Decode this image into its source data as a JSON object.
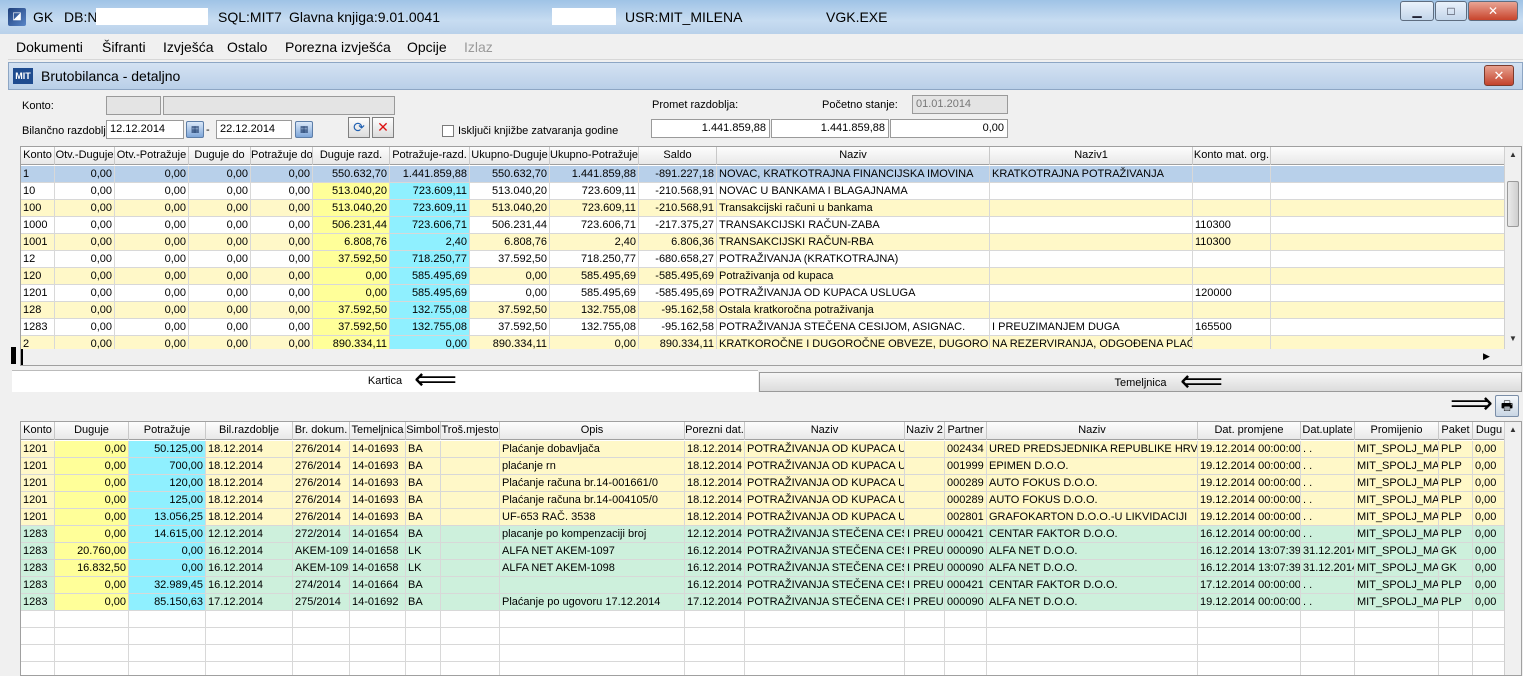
{
  "titlebar": {
    "app": "GK",
    "db": "DB:N",
    "sql": "SQL:MIT7",
    "ledger": "Glavna knjiga:9.01.0041",
    "user": "USR:MIT_MILENA",
    "exe": "VGK.EXE",
    "min": "▁",
    "max": "□",
    "close": "✕"
  },
  "menu": [
    "Dokumenti",
    "Šifranti",
    "Izvješća",
    "Ostalo",
    "Porezna izvješća",
    "Opcije",
    "Izlaz"
  ],
  "window": {
    "logo": "MIT",
    "title": "Brutobilanca - detaljno",
    "close": "✕"
  },
  "form": {
    "konto_label": "Konto:",
    "konto_value": "",
    "konto_name": "",
    "period_label": "Bilančno razdoblje:",
    "date_from": "12.12.2014",
    "date_sep": "-",
    "date_to": "22.12.2014",
    "checkbox_label": "Isključi knjižbe zatvaranja godine",
    "promet_label": "Promet razdoblja:",
    "pocetno_label": "Početno stanje:",
    "pocetno_value": "01.01.2014",
    "total_duguje": "1.441.859,88",
    "total_potrazuje": "1.441.859,88",
    "total_saldo": "0,00",
    "refresh_icon": "⟳",
    "clear_icon": "✕"
  },
  "top_grid": {
    "headers": [
      "Konto",
      "Otv.-Duguje",
      "Otv.-Potražuje",
      "Duguje do",
      "Potražuje do",
      "Duguje razd.",
      "Potražuje-razd.",
      "Ukupno-Duguje",
      "Ukupno-Potražuje",
      "Saldo",
      "Naziv",
      "Naziv1",
      "Konto mat. org."
    ],
    "rows": [
      [
        "1",
        "0,00",
        "0,00",
        "0,00",
        "0,00",
        "550.632,70",
        "1.441.859,88",
        "550.632,70",
        "1.441.859,88",
        "-891.227,18",
        "NOVAC, KRATKOTRAJNA FINANCIJSKA IMOVINA",
        "KRATKOTRAJNA POTRAŽIVANJA",
        ""
      ],
      [
        "10",
        "0,00",
        "0,00",
        "0,00",
        "0,00",
        "513.040,20",
        "723.609,11",
        "513.040,20",
        "723.609,11",
        "-210.568,91",
        "NOVAC U BANKAMA I BLAGAJNAMA",
        "",
        ""
      ],
      [
        "100",
        "0,00",
        "0,00",
        "0,00",
        "0,00",
        "513.040,20",
        "723.609,11",
        "513.040,20",
        "723.609,11",
        "-210.568,91",
        "Transakcijski računi u bankama",
        "",
        ""
      ],
      [
        "1000",
        "0,00",
        "0,00",
        "0,00",
        "0,00",
        "506.231,44",
        "723.606,71",
        "506.231,44",
        "723.606,71",
        "-217.375,27",
        "TRANSAKCIJSKI RAČUN-ZABA",
        "",
        "110300"
      ],
      [
        "1001",
        "0,00",
        "0,00",
        "0,00",
        "0,00",
        "6.808,76",
        "2,40",
        "6.808,76",
        "2,40",
        "6.806,36",
        "TRANSAKCIJSKI RAČUN-RBA",
        "",
        "110300"
      ],
      [
        "12",
        "0,00",
        "0,00",
        "0,00",
        "0,00",
        "37.592,50",
        "718.250,77",
        "37.592,50",
        "718.250,77",
        "-680.658,27",
        "POTRAŽIVANJA (KRATKOTRAJNA)",
        "",
        ""
      ],
      [
        "120",
        "0,00",
        "0,00",
        "0,00",
        "0,00",
        "0,00",
        "585.495,69",
        "0,00",
        "585.495,69",
        "-585.495,69",
        "Potraživanja od kupaca",
        "",
        ""
      ],
      [
        "1201",
        "0,00",
        "0,00",
        "0,00",
        "0,00",
        "0,00",
        "585.495,69",
        "0,00",
        "585.495,69",
        "-585.495,69",
        "POTRAŽIVANJA OD KUPACA USLUGA",
        "",
        "120000"
      ],
      [
        "128",
        "0,00",
        "0,00",
        "0,00",
        "0,00",
        "37.592,50",
        "132.755,08",
        "37.592,50",
        "132.755,08",
        "-95.162,58",
        "Ostala kratkoročna potraživanja",
        "",
        ""
      ],
      [
        "1283",
        "0,00",
        "0,00",
        "0,00",
        "0,00",
        "37.592,50",
        "132.755,08",
        "37.592,50",
        "132.755,08",
        "-95.162,58",
        "POTRAŽIVANJA STEČENA CESIJOM, ASIGNAC.",
        "I PREUZIMANJEM DUGA",
        "165500"
      ],
      [
        "2",
        "0,00",
        "0,00",
        "0,00",
        "0,00",
        "890.334,11",
        "0,00",
        "890.334,11",
        "0,00",
        "890.334,11",
        "KRATKOROČNE I DUGOROČNE OBVEZE, DUGOROČ",
        "NA REZERVIRANJA, ODGOĐENA PLAĆ",
        ""
      ]
    ]
  },
  "tabs": {
    "kartica": "Kartica",
    "temeljnica": "Temeljnica"
  },
  "bottom_grid": {
    "headers": [
      "Konto",
      "Duguje",
      "Potražuje",
      "Bil.razdoblje",
      "Br. dokum.",
      "Temeljnica",
      "Simbol",
      "Troš.mjesto",
      "Opis",
      "Porezni dat.",
      "Naziv",
      "Naziv 2",
      "Partner",
      "Naziv",
      "Dat. promjene",
      "Dat.uplate",
      "Promijenio",
      "Paket",
      "Dugu"
    ],
    "rows": [
      [
        "1201",
        "0,00",
        "50.125,00",
        "18.12.2014",
        "276/2014",
        "14-01693",
        "BA",
        "",
        "Plaćanje dobavljača",
        "18.12.2014",
        "POTRAŽIVANJA OD KUPACA U",
        "",
        "002434",
        "URED PREDSJEDNIKA REPUBLIKE HRV.",
        "19.12.2014 00:00:00",
        " .  .",
        "MIT_SPOLJ_MA",
        "PLP",
        "0,00"
      ],
      [
        "1201",
        "0,00",
        "700,00",
        "18.12.2014",
        "276/2014",
        "14-01693",
        "BA",
        "",
        "plaćanje rn",
        "18.12.2014",
        "POTRAŽIVANJA OD KUPACA U",
        "",
        "001999",
        "EPIMEN D.O.O.",
        "19.12.2014 00:00:00",
        " .  .",
        "MIT_SPOLJ_MA",
        "PLP",
        "0,00"
      ],
      [
        "1201",
        "0,00",
        "120,00",
        "18.12.2014",
        "276/2014",
        "14-01693",
        "BA",
        "",
        "Plaćanje računa br.14-001661/0",
        "18.12.2014",
        "POTRAŽIVANJA OD KUPACA U",
        "",
        "000289",
        "AUTO FOKUS D.O.O.",
        "19.12.2014 00:00:00",
        " .  .",
        "MIT_SPOLJ_MA",
        "PLP",
        "0,00"
      ],
      [
        "1201",
        "0,00",
        "125,00",
        "18.12.2014",
        "276/2014",
        "14-01693",
        "BA",
        "",
        "Plaćanje računa br.14-004105/0",
        "18.12.2014",
        "POTRAŽIVANJA OD KUPACA U",
        "",
        "000289",
        "AUTO FOKUS D.O.O.",
        "19.12.2014 00:00:00",
        " .  .",
        "MIT_SPOLJ_MA",
        "PLP",
        "0,00"
      ],
      [
        "1201",
        "0,00",
        "13.056,25",
        "18.12.2014",
        "276/2014",
        "14-01693",
        "BA",
        "",
        "UF-653 RAČ. 3538",
        "18.12.2014",
        "POTRAŽIVANJA OD KUPACA U",
        "",
        "002801",
        "GRAFOKARTON D.O.O.-U LIKVIDACIJI",
        "19.12.2014 00:00:00",
        " .  .",
        "MIT_SPOLJ_MA",
        "PLP",
        "0,00"
      ],
      [
        "1283",
        "0,00",
        "14.615,00",
        "12.12.2014",
        "272/2014",
        "14-01654",
        "BA",
        "",
        "placanje po kompenzaciji broj",
        "12.12.2014",
        "POTRAŽIVANJA STEČENA CES",
        "I PREUZ",
        "000421",
        "CENTAR FAKTOR D.O.O.",
        "16.12.2014 00:00:00",
        " .  .",
        "MIT_SPOLJ_MA",
        "PLP",
        "0,00"
      ],
      [
        "1283",
        "20.760,00",
        "0,00",
        "16.12.2014",
        "AKEM-1097",
        "14-01658",
        "LK",
        "",
        "ALFA NET AKEM-1097",
        "16.12.2014",
        "POTRAŽIVANJA STEČENA CES",
        "I PREUZ",
        "000090",
        "ALFA NET D.O.O.",
        "16.12.2014 13:07:39",
        "31.12.2014",
        "MIT_SPOLJ_MA",
        "GK",
        "0,00"
      ],
      [
        "1283",
        "16.832,50",
        "0,00",
        "16.12.2014",
        "AKEM-1098",
        "14-01658",
        "LK",
        "",
        "ALFA NET AKEM-1098",
        "16.12.2014",
        "POTRAŽIVANJA STEČENA CES",
        "I PREUZ",
        "000090",
        "ALFA NET D.O.O.",
        "16.12.2014 13:07:39",
        "31.12.2014",
        "MIT_SPOLJ_MA",
        "GK",
        "0,00"
      ],
      [
        "1283",
        "0,00",
        "32.989,45",
        "16.12.2014",
        "274/2014",
        "14-01664",
        "BA",
        "",
        "",
        "16.12.2014",
        "POTRAŽIVANJA STEČENA CES",
        "I PREUZ",
        "000421",
        "CENTAR FAKTOR D.O.O.",
        "17.12.2014 00:00:00",
        " .  .",
        "MIT_SPOLJ_MA",
        "PLP",
        "0,00"
      ],
      [
        "1283",
        "0,00",
        "85.150,63",
        "17.12.2014",
        "275/2014",
        "14-01692",
        "BA",
        "",
        "Plaćanje po ugovoru 17.12.2014",
        "17.12.2014",
        "POTRAŽIVANJA STEČENA CES",
        "I PREUZ",
        "000090",
        "ALFA NET D.O.O.",
        "19.12.2014 00:00:00",
        " .  .",
        "MIT_SPOLJ_MA",
        "PLP",
        "0,00"
      ]
    ]
  },
  "print_icon": "🖶",
  "arrow_glyph": "⟸"
}
